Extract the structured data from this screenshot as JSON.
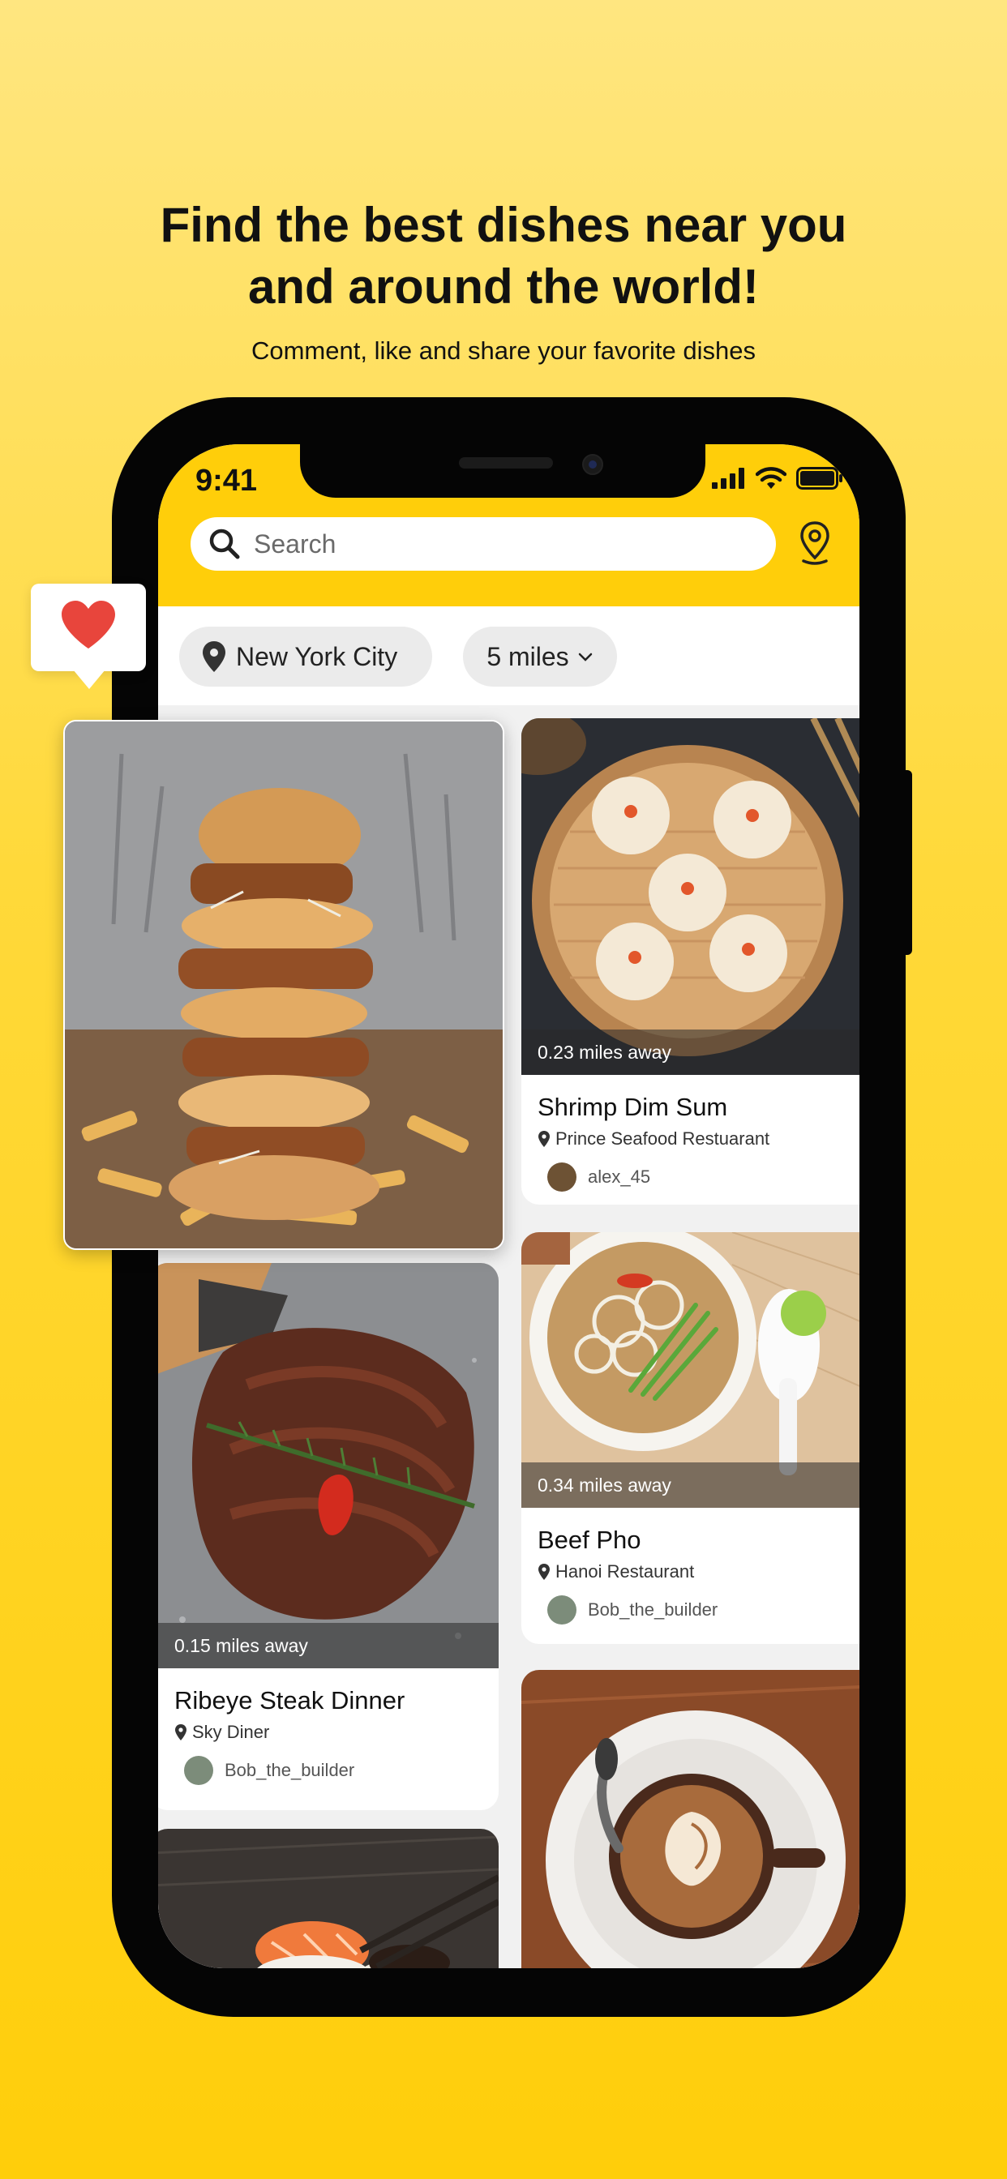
{
  "promo": {
    "headline_line1": "Find the best dishes near you",
    "headline_line2": "and around the world!",
    "subheadline": "Comment, like and share your favorite dishes"
  },
  "status_bar": {
    "time": "9:41"
  },
  "search": {
    "placeholder": "Search"
  },
  "filters": {
    "location": "New York City",
    "radius": "5 miles"
  },
  "colors": {
    "brand": "#FFCE0A",
    "heart": "#E8453C"
  },
  "cards": [
    {
      "distance": "0.23 miles away",
      "title": "Shrimp Dim Sum",
      "restaurant": "Prince Seafood Restuarant",
      "user": "alex_45"
    },
    {
      "distance": "0.15 miles away",
      "title": "Ribeye Steak Dinner",
      "restaurant": "Sky Diner",
      "user": "Bob_the_builder"
    },
    {
      "distance": "0.34 miles away",
      "title": "Beef Pho",
      "restaurant": "Hanoi Restaurant",
      "user": "Bob_the_builder"
    }
  ],
  "icons": [
    "search-icon",
    "map-pin-icon",
    "chevron-down-icon",
    "heart-icon",
    "signal-icon",
    "wifi-icon",
    "battery-icon",
    "location-pin-icon"
  ]
}
